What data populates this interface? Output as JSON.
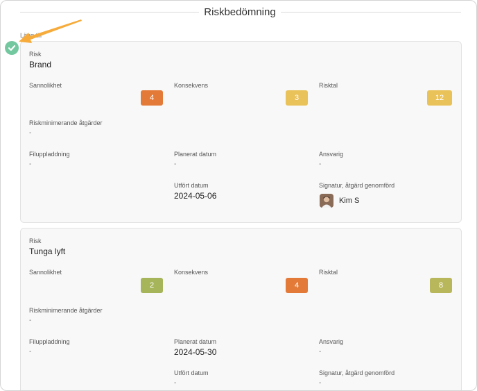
{
  "section": {
    "title": "Riskbedömning"
  },
  "reported_by_label": "Lägg till",
  "risks": [
    {
      "risk_label": "Risk",
      "risk": "Brand",
      "likelihood_label": "Sannolikhet",
      "likelihood": "4",
      "likelihood_color": "#e37a38",
      "consequence_label": "Konsekvens",
      "consequence": "3",
      "consequence_color": "#eac25a",
      "risk_number_label": "Risktal",
      "risk_number": "12",
      "risk_number_color": "#eac25a",
      "measures_label": "Riskminimerande åtgärder",
      "measures": "-",
      "upload_label": "Filuppladdning",
      "upload": "-",
      "planned_label": "Planerat datum",
      "planned": "-",
      "responsible_label": "Ansvarig",
      "responsible": "-",
      "done_label": "Utfört datum",
      "done": "2024-05-06",
      "signature_label": "Signatur, åtgärd genomförd",
      "signature_name": "Kim S"
    },
    {
      "risk_label": "Risk",
      "risk": "Tunga lyft",
      "likelihood_label": "Sannolikhet",
      "likelihood": "2",
      "likelihood_color": "#a7b55a",
      "consequence_label": "Konsekvens",
      "consequence": "4",
      "consequence_color": "#e37a38",
      "risk_number_label": "Risktal",
      "risk_number": "8",
      "risk_number_color": "#b9b75c",
      "measures_label": "Riskminimerande åtgärder",
      "measures": "-",
      "upload_label": "Filuppladdning",
      "upload": "-",
      "planned_label": "Planerat datum",
      "planned": "2024-05-30",
      "responsible_label": "Ansvarig",
      "responsible": "-",
      "done_label": "Utfört datum",
      "done": "-",
      "signature_label": "Signatur, åtgärd genomförd",
      "signature_name": "-"
    }
  ],
  "colors": {
    "check": "#74c8a0",
    "arrow": "#f6ab3a"
  }
}
